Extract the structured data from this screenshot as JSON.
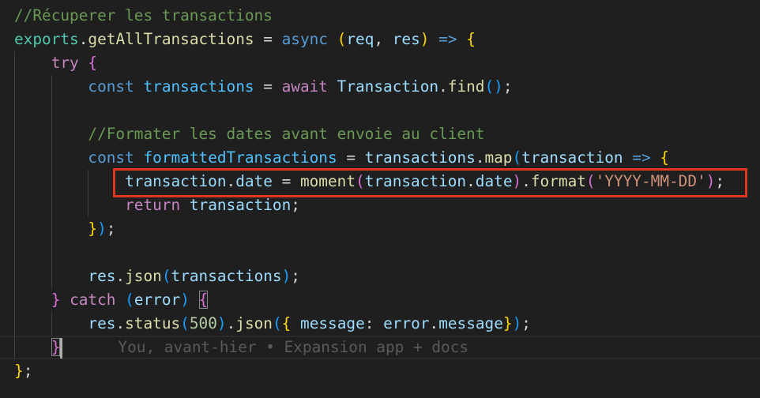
{
  "colors": {
    "background": "#1f1f1f",
    "highlight_box": "#e0361f"
  },
  "editor": {
    "lines": [
      {
        "tokens": [
          [
            "//Récuperer les transactions",
            "comment"
          ]
        ]
      },
      {
        "tokens": [
          [
            "exports",
            "cls"
          ],
          [
            ".",
            "punc"
          ],
          [
            "getAllTransactions",
            "fn"
          ],
          [
            " = ",
            "punc"
          ],
          [
            "async",
            "kw"
          ],
          [
            " ",
            "punc"
          ],
          [
            "(",
            "b1"
          ],
          [
            "req",
            "var"
          ],
          [
            ", ",
            "punc"
          ],
          [
            "res",
            "var"
          ],
          [
            ")",
            "b1"
          ],
          [
            " ",
            "punc"
          ],
          [
            "=>",
            "kw"
          ],
          [
            " ",
            "punc"
          ],
          [
            "{",
            "b1"
          ]
        ]
      },
      {
        "indent": 1,
        "tokens": [
          [
            "try",
            "ctl"
          ],
          [
            " ",
            "punc"
          ],
          [
            "{",
            "b2"
          ]
        ]
      },
      {
        "indent": 2,
        "tokens": [
          [
            "const",
            "kw"
          ],
          [
            " ",
            "punc"
          ],
          [
            "transactions",
            "const"
          ],
          [
            " = ",
            "punc"
          ],
          [
            "await",
            "ctl"
          ],
          [
            " ",
            "punc"
          ],
          [
            "Transaction",
            "var"
          ],
          [
            ".",
            "punc"
          ],
          [
            "find",
            "fn"
          ],
          [
            "()",
            "b3"
          ],
          [
            ";",
            "punc"
          ]
        ]
      },
      {
        "indent": 2,
        "tokens": []
      },
      {
        "indent": 2,
        "tokens": [
          [
            "//Formater les dates avant envoie au client",
            "comment"
          ]
        ]
      },
      {
        "indent": 2,
        "tokens": [
          [
            "const",
            "kw"
          ],
          [
            " ",
            "punc"
          ],
          [
            "formattedTransactions",
            "const"
          ],
          [
            " = ",
            "punc"
          ],
          [
            "transactions",
            "var"
          ],
          [
            ".",
            "punc"
          ],
          [
            "map",
            "fn"
          ],
          [
            "(",
            "b3"
          ],
          [
            "transaction",
            "var"
          ],
          [
            " ",
            "punc"
          ],
          [
            "=>",
            "kw"
          ],
          [
            " ",
            "punc"
          ],
          [
            "{",
            "b1"
          ]
        ]
      },
      {
        "indent": 3,
        "tokens": [
          [
            "transaction",
            "var"
          ],
          [
            ".",
            "punc"
          ],
          [
            "date",
            "var"
          ],
          [
            " = ",
            "punc"
          ],
          [
            "moment",
            "fn"
          ],
          [
            "(",
            "b2"
          ],
          [
            "transaction",
            "var"
          ],
          [
            ".",
            "punc"
          ],
          [
            "date",
            "var"
          ],
          [
            ")",
            "b2"
          ],
          [
            ".",
            "punc"
          ],
          [
            "format",
            "fn"
          ],
          [
            "(",
            "b2"
          ],
          [
            "'YYYY-MM-DD'",
            "str"
          ],
          [
            ")",
            "b2"
          ],
          [
            ";",
            "punc"
          ]
        ]
      },
      {
        "indent": 3,
        "tokens": [
          [
            "return",
            "ctl"
          ],
          [
            " ",
            "punc"
          ],
          [
            "transaction",
            "var"
          ],
          [
            ";",
            "punc"
          ]
        ]
      },
      {
        "indent": 2,
        "tokens": [
          [
            "}",
            "b1"
          ],
          [
            ")",
            "b3"
          ],
          [
            ";",
            "punc"
          ]
        ]
      },
      {
        "indent": 2,
        "tokens": []
      },
      {
        "indent": 2,
        "tokens": [
          [
            "res",
            "var"
          ],
          [
            ".",
            "punc"
          ],
          [
            "json",
            "fn"
          ],
          [
            "(",
            "b3"
          ],
          [
            "transactions",
            "var"
          ],
          [
            ")",
            "b3"
          ],
          [
            ";",
            "punc"
          ]
        ]
      },
      {
        "indent": 1,
        "tokens": [
          [
            "}",
            "b2"
          ],
          [
            " ",
            "punc"
          ],
          [
            "catch",
            "ctl"
          ],
          [
            " ",
            "punc"
          ],
          [
            "(",
            "b3"
          ],
          [
            "error",
            "var"
          ],
          [
            ")",
            "b3"
          ],
          [
            " ",
            "punc"
          ],
          [
            "{",
            "b2 match"
          ]
        ]
      },
      {
        "indent": 2,
        "tokens": [
          [
            "res",
            "var"
          ],
          [
            ".",
            "punc"
          ],
          [
            "status",
            "fn"
          ],
          [
            "(",
            "b3"
          ],
          [
            "500",
            "num"
          ],
          [
            ")",
            "b3"
          ],
          [
            ".",
            "punc"
          ],
          [
            "json",
            "fn"
          ],
          [
            "(",
            "b3"
          ],
          [
            "{",
            "b1"
          ],
          [
            " ",
            "punc"
          ],
          [
            "message",
            "var"
          ],
          [
            ": ",
            "punc"
          ],
          [
            "error",
            "var"
          ],
          [
            ".",
            "punc"
          ],
          [
            "message",
            "var"
          ],
          [
            "}",
            "b1"
          ],
          [
            ")",
            "b3"
          ],
          [
            ";",
            "punc"
          ]
        ]
      },
      {
        "indent": 1,
        "current": true,
        "tokens": [
          [
            "}",
            "b2 match"
          ]
        ],
        "blame": "You, avant-hier • Expansion app + docs"
      },
      {
        "tokens": [
          [
            "}",
            "b1"
          ],
          [
            ";",
            "punc"
          ]
        ]
      }
    ]
  }
}
